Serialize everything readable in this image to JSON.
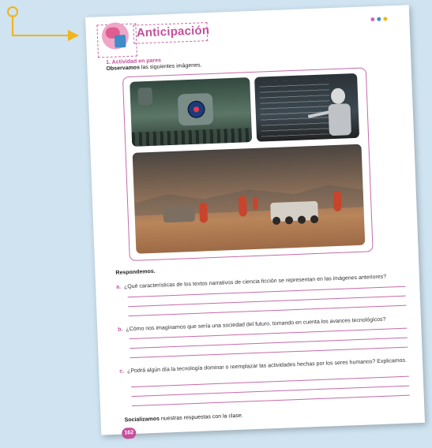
{
  "colors": {
    "background": "#cfe3f1",
    "accent": "#c54f9c",
    "arrow": "#f2b418",
    "dots": [
      "#d36ab2",
      "#3f8cc8",
      "#f2b418"
    ]
  },
  "header": {
    "section_title": "Anticipación",
    "icon": "brain-book-icon"
  },
  "activity": {
    "label": "1.  Actividad en pares",
    "instruction_bold": "Observamos",
    "instruction_rest": " las siguientes imágenes."
  },
  "images": [
    {
      "name": "surveillance-camera-image"
    },
    {
      "name": "robot-blackboard-image"
    },
    {
      "name": "mars-astronauts-image"
    }
  ],
  "questions": {
    "heading": "Respondemos.",
    "items": [
      {
        "letter": "a.",
        "text": "¿Qué características de los textos narrativos de ciencia ficción se representan en las imágenes anteriores?"
      },
      {
        "letter": "b.",
        "text": "¿Cómo nos imaginamos que sería una sociedad del futuro, tomando en cuenta los avances tecnológicos?"
      },
      {
        "letter": "c.",
        "text": "¿Podrá algún día la tecnología dominar o reemplazar las actividades hechas por los seres humanos? Explicamos."
      }
    ]
  },
  "footer": {
    "social_bold": "Socializamos",
    "social_rest": " nuestras respuestas con la clase.",
    "page_number": "162"
  }
}
